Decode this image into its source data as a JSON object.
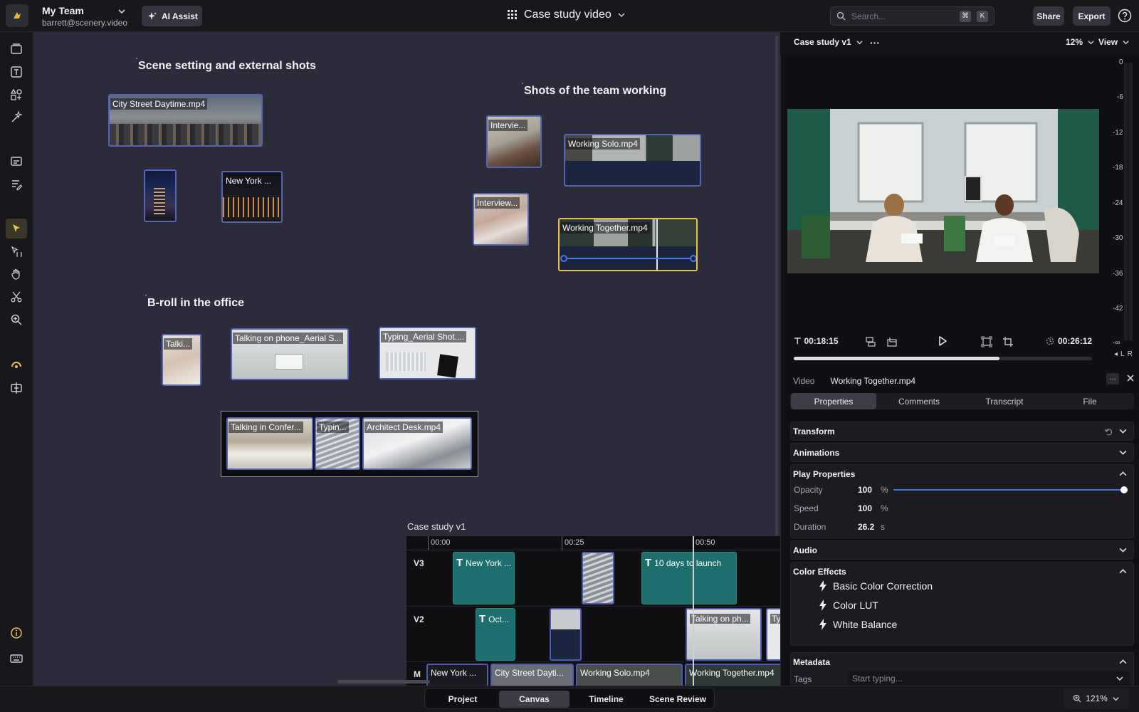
{
  "topbar": {
    "team_name": "My Team",
    "team_email": "barrett@scenery.video",
    "ai_assist_label": "AI Assist",
    "project_title": "Case study video",
    "search_placeholder": "Search...",
    "search_shortcut": [
      "⌘",
      "K"
    ],
    "share_label": "Share",
    "export_label": "Export"
  },
  "canvas": {
    "groups": [
      {
        "title": "Scene setting and external shots"
      },
      {
        "title": "Shots of the team working"
      },
      {
        "title": "B-roll in the office"
      }
    ],
    "clips": [
      {
        "label": "City Street Daytime.mp4"
      },
      {
        "label": ""
      },
      {
        "label": "New York ..."
      },
      {
        "label": "Intervie..."
      },
      {
        "label": "Working Solo.mp4"
      },
      {
        "label": "Interview..."
      },
      {
        "label": "Working Together.mp4"
      },
      {
        "label": "Talki..."
      },
      {
        "label": "Talking on phone_Aerial S..."
      },
      {
        "label": "Typing_Aerial Shot...."
      },
      {
        "label": "Talking in Confer..."
      },
      {
        "label": "Typin..."
      },
      {
        "label": "Architect Desk.mp4"
      }
    ]
  },
  "timeline": {
    "title": "Case study v1",
    "ticks": [
      "00:00",
      "00:25",
      "00:50"
    ],
    "tracks": [
      "V3",
      "V2",
      "M"
    ],
    "clips": [
      {
        "label": "New York ..."
      },
      {
        "label": "10 days to launch"
      },
      {
        "label": "Oct..."
      },
      {
        "label": "Talking on ph..."
      },
      {
        "label": "Typi"
      },
      {
        "label": "New York ..."
      },
      {
        "label": "City Street Dayti..."
      },
      {
        "label": "Working Solo.mp4"
      },
      {
        "label": "Working Together.mp4"
      }
    ]
  },
  "viewer": {
    "sequence_name": "Case study v1",
    "more": "···",
    "zoom": "12%",
    "view_label": "View",
    "meter_labels": [
      "0",
      "-6",
      "-12",
      "-18",
      "-24",
      "-30",
      "-36",
      "-42",
      "-∞"
    ],
    "meter_lr": [
      "L",
      "R"
    ],
    "current_time": "00:18:15",
    "total_time": "00:26:12",
    "progress": 0.69
  },
  "inspector": {
    "type_label": "Video",
    "clip_name": "Working Together.mp4",
    "tabs": [
      "Properties",
      "Comments",
      "Transcript",
      "File"
    ],
    "sections": {
      "transform": "Transform",
      "animations": "Animations",
      "play_properties": "Play Properties",
      "audio": "Audio",
      "color_effects": "Color Effects",
      "metadata": "Metadata"
    },
    "properties": {
      "opacity_label": "Opacity",
      "opacity_value": "100",
      "opacity_unit": "%",
      "opacity_level": 1.0,
      "speed_label": "Speed",
      "speed_value": "100",
      "speed_unit": "%",
      "duration_label": "Duration",
      "duration_value": "26.2",
      "duration_unit": "s"
    },
    "effects": [
      "Basic Color Correction",
      "Color LUT",
      "White Balance"
    ],
    "tags_label": "Tags",
    "tags_placeholder": "Start typing..."
  },
  "bottombar": {
    "views": [
      "Project",
      "Canvas",
      "Timeline",
      "Scene Review"
    ],
    "active_view": "Canvas",
    "zoom": "121%"
  },
  "colors": {
    "accent": "#e8c04c",
    "clip_border": "#5565b5",
    "teal": "#1d6e6c",
    "canvas_bg": "#2b2b3c",
    "slider": "#3a77e0"
  }
}
